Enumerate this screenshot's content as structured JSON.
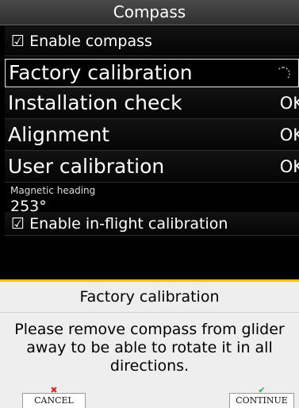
{
  "title": "Compass",
  "enable_compass": {
    "glyph": "☑",
    "label": "Enable compass"
  },
  "menu": [
    {
      "label": "Factory calibration",
      "status": ""
    },
    {
      "label": "Installation check",
      "status": "OK"
    },
    {
      "label": "Alignment",
      "status": "OK"
    },
    {
      "label": "User calibration",
      "status": "OK"
    }
  ],
  "magnetic_heading": {
    "label": "Magnetic heading",
    "value": "253°"
  },
  "enable_inflight": {
    "glyph": "☑",
    "label": "Enable in-flight calibration"
  },
  "dialog": {
    "title": "Factory calibration",
    "message": "Please remove compass from glider away to be able to rotate it in all directions.",
    "accent_color": "#f2c100"
  },
  "softkeys": {
    "cancel": {
      "label": "CANCEL",
      "icon": "✖",
      "icon_color": "#d9262c"
    },
    "continue": {
      "label": "CONTINUE",
      "icon": "✔",
      "icon_color": "#2ea84a"
    }
  }
}
